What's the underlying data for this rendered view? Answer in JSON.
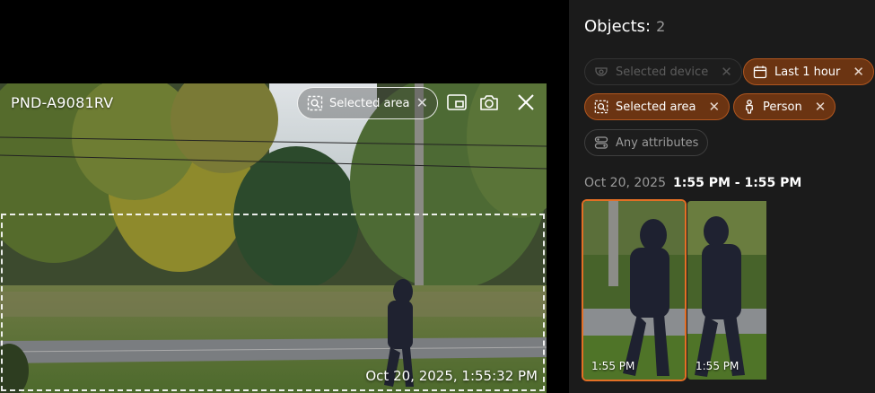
{
  "camera": {
    "name": "PND-A9081RV",
    "area_pill_label": "Selected area",
    "timestamp": "Oct 20, 2025, 1:55:32 PM"
  },
  "panel": {
    "title": "Objects:",
    "count": "2",
    "filters": {
      "device": "Selected device",
      "time": "Last 1 hour",
      "area": "Selected area",
      "person": "Person",
      "attributes": "Any attributes"
    },
    "group": {
      "date": "Oct 20, 2025",
      "range": "1:55 PM - 1:55 PM"
    },
    "thumbnails": [
      {
        "time": "1:55 PM",
        "selected": true
      },
      {
        "time": "1:55 PM",
        "selected": false
      }
    ]
  },
  "colors": {
    "accent": "#e36f25",
    "chip_active_bg": "#6b3412",
    "panel_bg": "#1b1b1b"
  }
}
